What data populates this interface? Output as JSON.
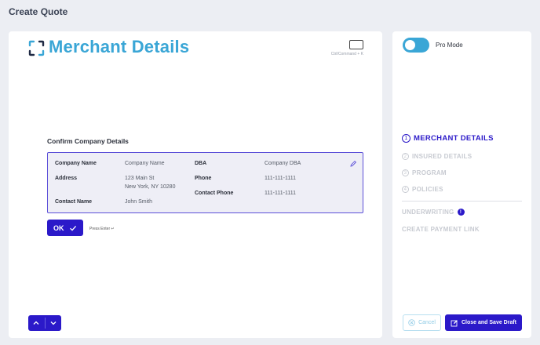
{
  "page": {
    "title": "Create Quote"
  },
  "main": {
    "title": "Merchant Details",
    "shortcut_hint": "Ctrl/Command + K",
    "section_heading": "Confirm Company Details",
    "details": {
      "company_name_label": "Company Name",
      "company_name_value": "Company Name",
      "address_label": "Address",
      "address_line1": "123 Main St",
      "address_line2": "New York, NY 10280",
      "contact_name_label": "Contact Name",
      "contact_name_value": "John Smith",
      "dba_label": "DBA",
      "dba_value": "Company DBA",
      "phone_label": "Phone",
      "phone_value": "111-111-1111",
      "contact_phone_label": "Contact Phone",
      "contact_phone_value": "111-111-1111"
    },
    "ok_label": "OK",
    "enter_hint": "Press Enter ↵"
  },
  "sidebar": {
    "pro_mode_label": "Pro Mode",
    "pro_mode_on": true,
    "steps": [
      {
        "number": "1",
        "label": "MERCHANT DETAILS",
        "active": true
      },
      {
        "number": "2",
        "label": "INSURED DETAILS",
        "active": false
      },
      {
        "number": "3",
        "label": "PROGRAM",
        "active": false
      },
      {
        "number": "4",
        "label": "POLICIES",
        "active": false
      }
    ],
    "extra_steps": {
      "underwriting": "UNDERWRITING",
      "underwriting_badge": "!",
      "payment_link": "CREATE PAYMENT LINK"
    },
    "cancel_label": "Cancel",
    "save_label": "Close and Save Draft"
  },
  "colors": {
    "accent": "#2b19c9",
    "brand": "#3aa6d6",
    "muted": "#c7cad1"
  }
}
